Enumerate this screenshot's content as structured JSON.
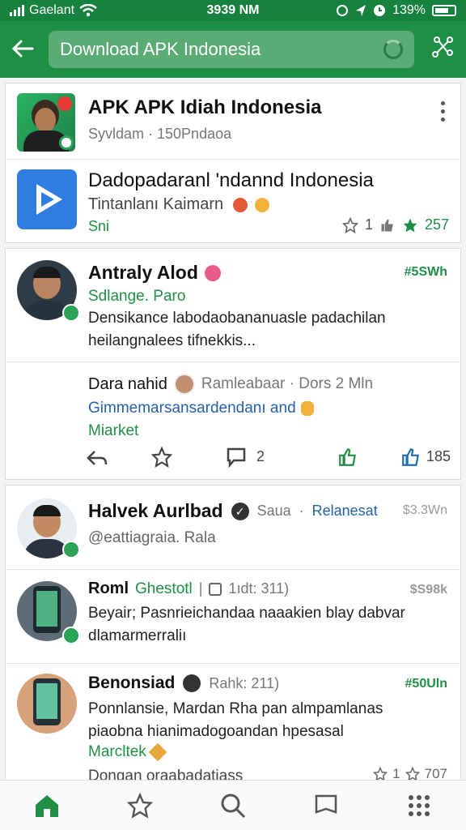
{
  "status": {
    "carrier": "Gaelant",
    "time": "3939 NM",
    "battery": "139%"
  },
  "search": {
    "value": "Download APK Indonesia"
  },
  "app_card": {
    "title": "APK APK Idiah Indonesia",
    "sub": "Syvldam · 150Pndaoa"
  },
  "app2": {
    "title": "Dadopadaranl 'ndannd Indonesia",
    "sub": "Tintanlanı Kaimarn",
    "tag": "Sni",
    "star_count": "1",
    "like_count": "257"
  },
  "post1": {
    "name": "Antraly Alod",
    "handle": "Sdlange. Paro",
    "metric": "#5SWh",
    "text": "Densikance labodaobananuasle padachilan heilangnalees tifnekkis...",
    "reply_name": "Dara nahid",
    "reply_meta": "Ramleabaar · Dors 2 Mln",
    "reply_text": "Gimmemarsansardendanı and",
    "reply_tag": "Miarket",
    "comment_count": "2",
    "share_count": "185"
  },
  "post2": {
    "name": "Halvek Aurlbad",
    "meta_a": "Saua",
    "meta_b": "Relanesat",
    "metric": "$3.3Wn",
    "handle": "@eattiagraia. Rala"
  },
  "post3": {
    "name": "Roml",
    "tag": "Ghestotl",
    "meta": "1ıdt: 311)",
    "metric": "$S98k",
    "text": "Beyair; Pasnrieichandaa naaakien blay dabvar dlamarmerraliı"
  },
  "post4": {
    "name": "Benonsiad",
    "meta": "Rahk: 211)",
    "metric": "#50Uln",
    "text": "Ponnlansie, Mardan Rha pan almpamlanas piaobna hianimadogoandan hpesasal",
    "tag": "Marcltek",
    "footer": "Dongan oraabadatiass",
    "star_count": "1",
    "count": "707"
  },
  "icons": {
    "back": "back-arrow-icon",
    "share": "share-network-icon",
    "home": "home-icon",
    "star": "star-icon",
    "search": "search-icon",
    "book": "book-icon",
    "grid": "grid-icon"
  },
  "colors": {
    "brand": "#1f8f46",
    "accent_blue": "#2661a8"
  }
}
